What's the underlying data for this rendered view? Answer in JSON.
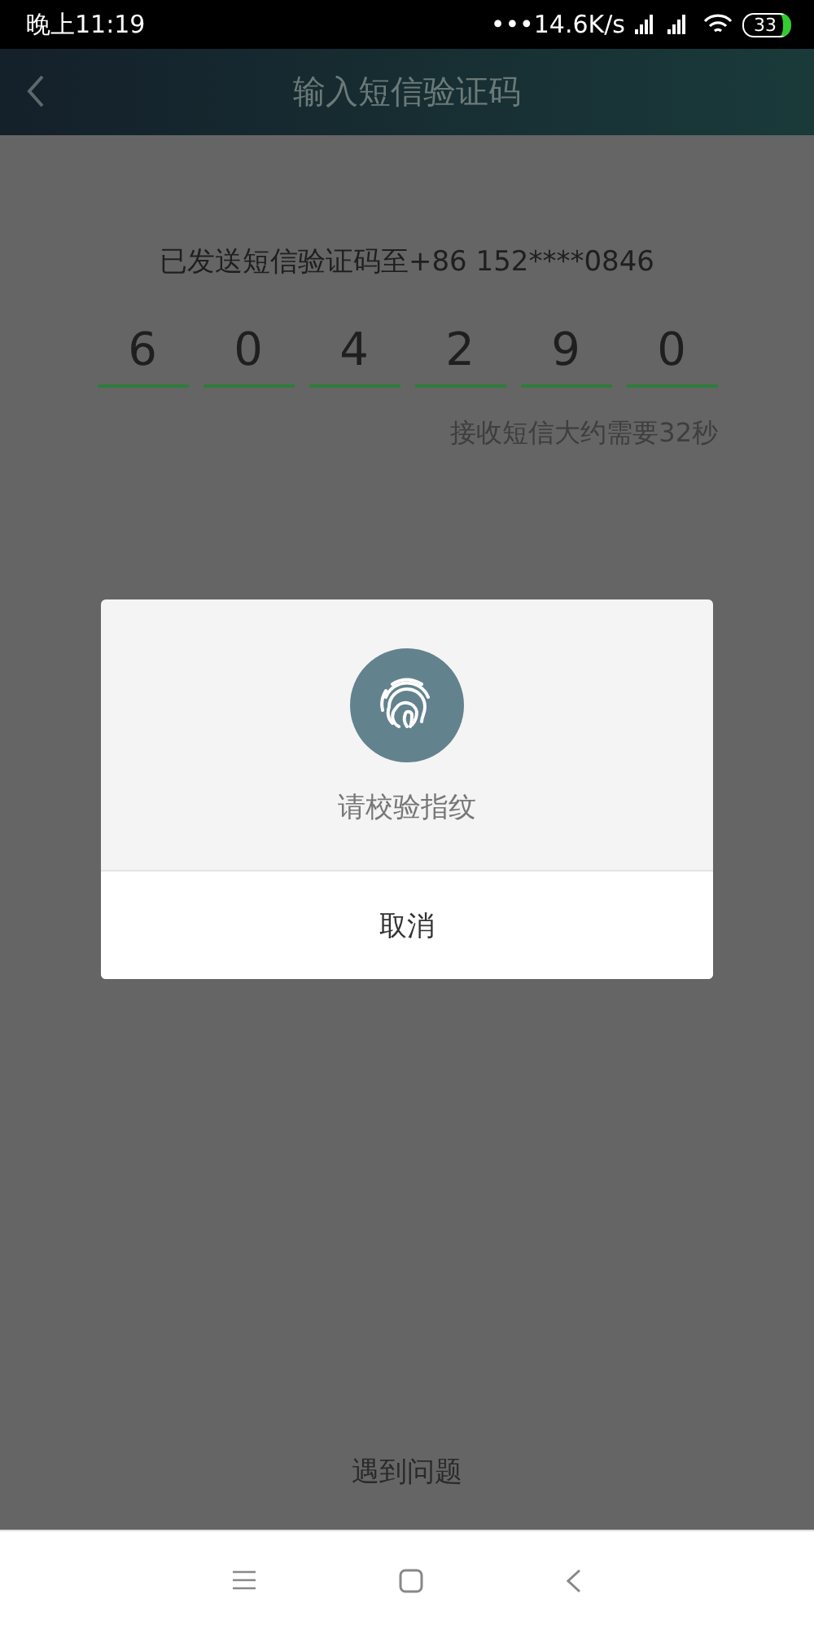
{
  "status_bar": {
    "time": "晚上11:19",
    "network_speed": "•••14.6K/s",
    "battery": "33"
  },
  "header": {
    "title": "输入短信验证码"
  },
  "sent_message": "已发送短信验证码至+86 152****0846",
  "code_digits": [
    "6",
    "0",
    "4",
    "2",
    "9",
    "0"
  ],
  "wait_hint": "接收短信大约需要32秒",
  "help_link": "遇到问题",
  "dialog": {
    "message": "请校验指纹",
    "cancel": "取消"
  }
}
